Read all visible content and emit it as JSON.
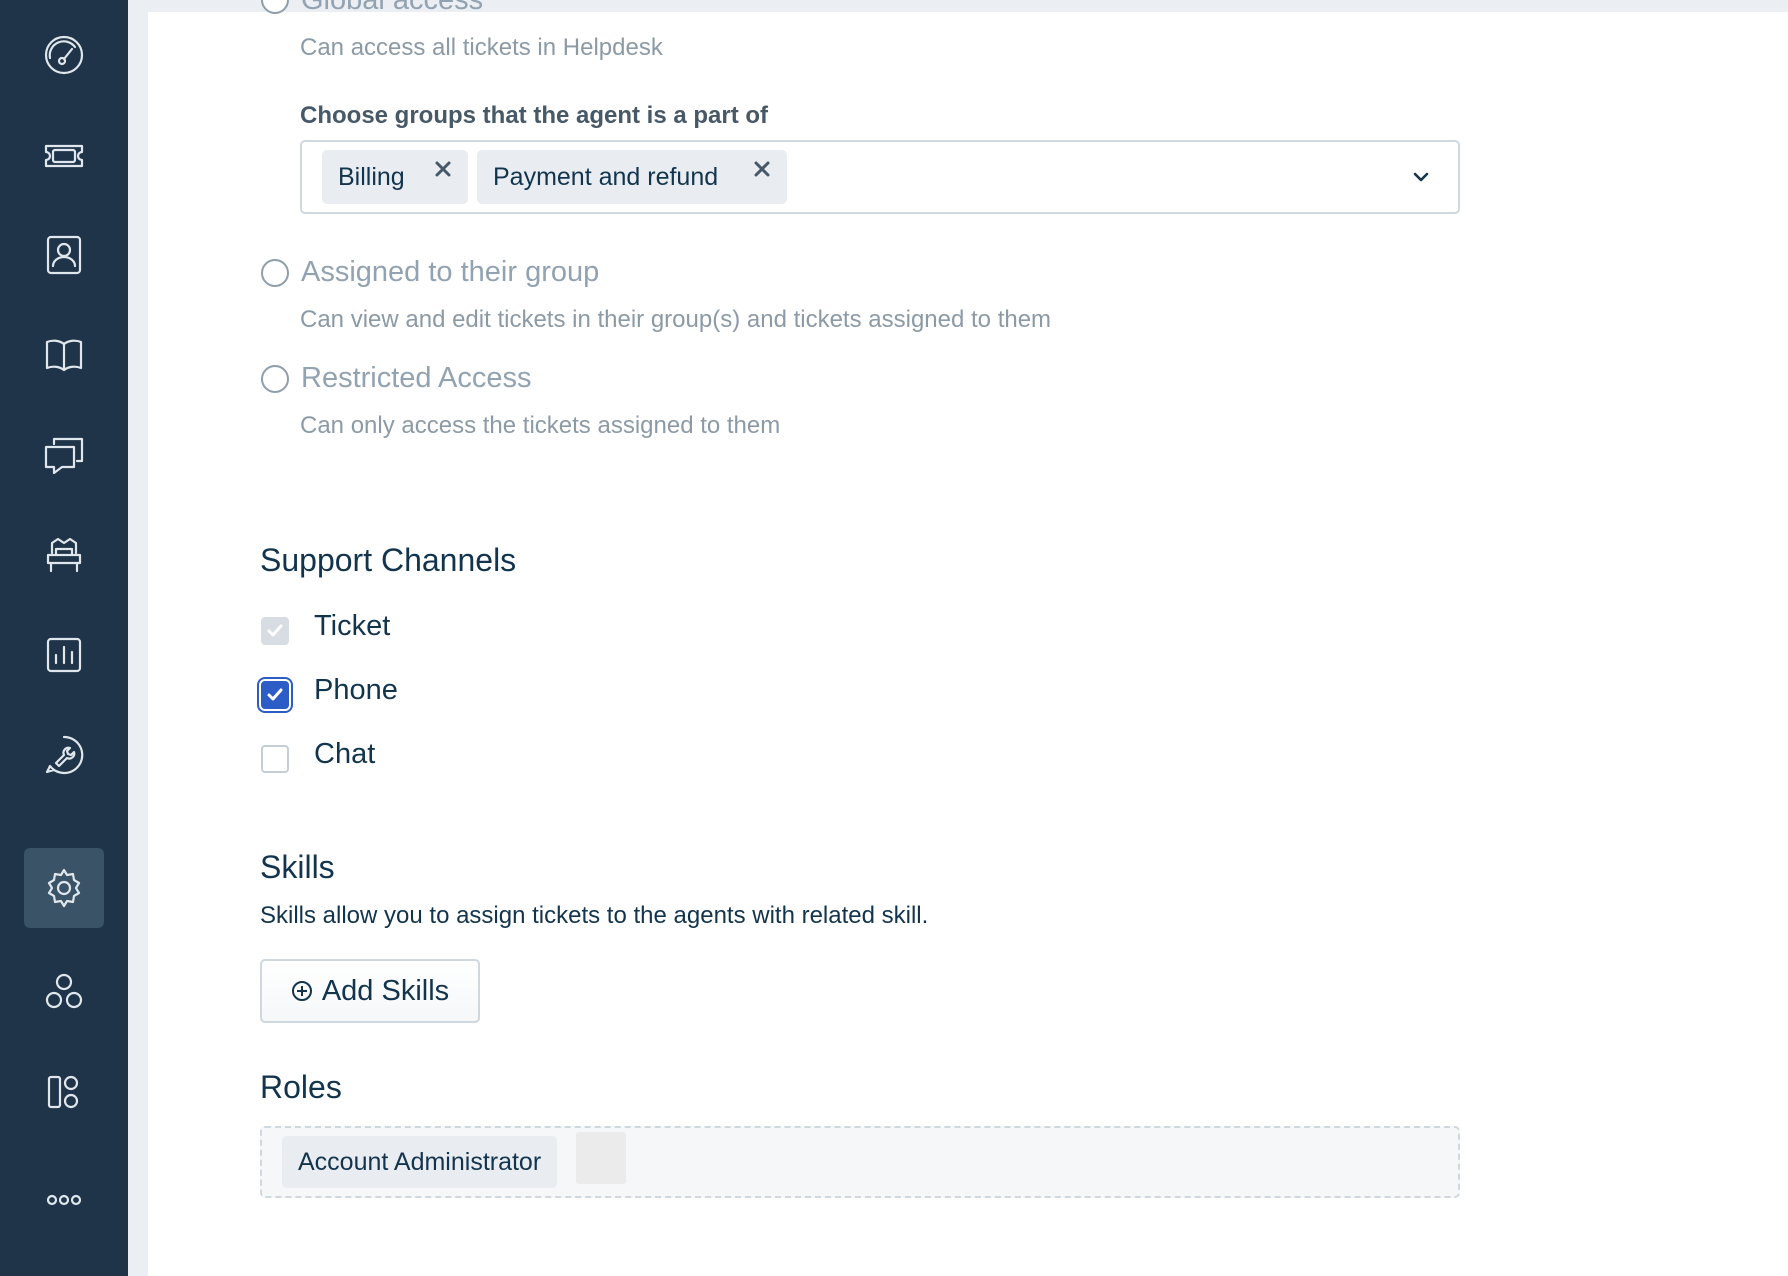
{
  "sidebar": {
    "items": [
      {
        "icon": "dashboard-icon"
      },
      {
        "icon": "tickets-icon"
      },
      {
        "icon": "contacts-icon"
      },
      {
        "icon": "solutions-book-icon"
      },
      {
        "icon": "discussions-icon"
      },
      {
        "icon": "social-chair-icon"
      },
      {
        "icon": "reports-icon"
      },
      {
        "icon": "admin-wrench-icon"
      },
      {
        "icon": "settings-gear-icon",
        "active": true
      },
      {
        "icon": "apps-hexagon-icon"
      },
      {
        "icon": "marketplace-grid-icon"
      },
      {
        "icon": "more-dots-icon"
      }
    ]
  },
  "ticket_scope": {
    "global_access": {
      "title": "Global access",
      "description": "Can access all tickets in Helpdesk"
    },
    "groups_label": "Choose groups that the agent is a part of",
    "groups_selected": [
      "Billing",
      "Payment and refund"
    ],
    "assigned_to_group": {
      "title": "Assigned to their group",
      "description": "Can view and edit tickets in their group(s) and tickets assigned to them"
    },
    "restricted_access": {
      "title": "Restricted Access",
      "description": "Can only access the tickets assigned to them"
    }
  },
  "support_channels": {
    "heading": "Support Channels",
    "channels": [
      {
        "label": "Ticket",
        "checked": true,
        "disabled": true
      },
      {
        "label": "Phone",
        "checked": true,
        "disabled": false
      },
      {
        "label": "Chat",
        "checked": false,
        "disabled": false
      }
    ]
  },
  "skills": {
    "heading": "Skills",
    "description": "Skills allow you to assign tickets to the agents with related skill.",
    "add_button": "Add Skills"
  },
  "roles": {
    "heading": "Roles",
    "selected": [
      "Account Administrator"
    ]
  },
  "colors": {
    "sidebar_bg": "#1f3449",
    "sidebar_active": "#3b5366",
    "primary": "#2c5cc5",
    "text": "#12344d",
    "muted": "#8c9aa6"
  }
}
